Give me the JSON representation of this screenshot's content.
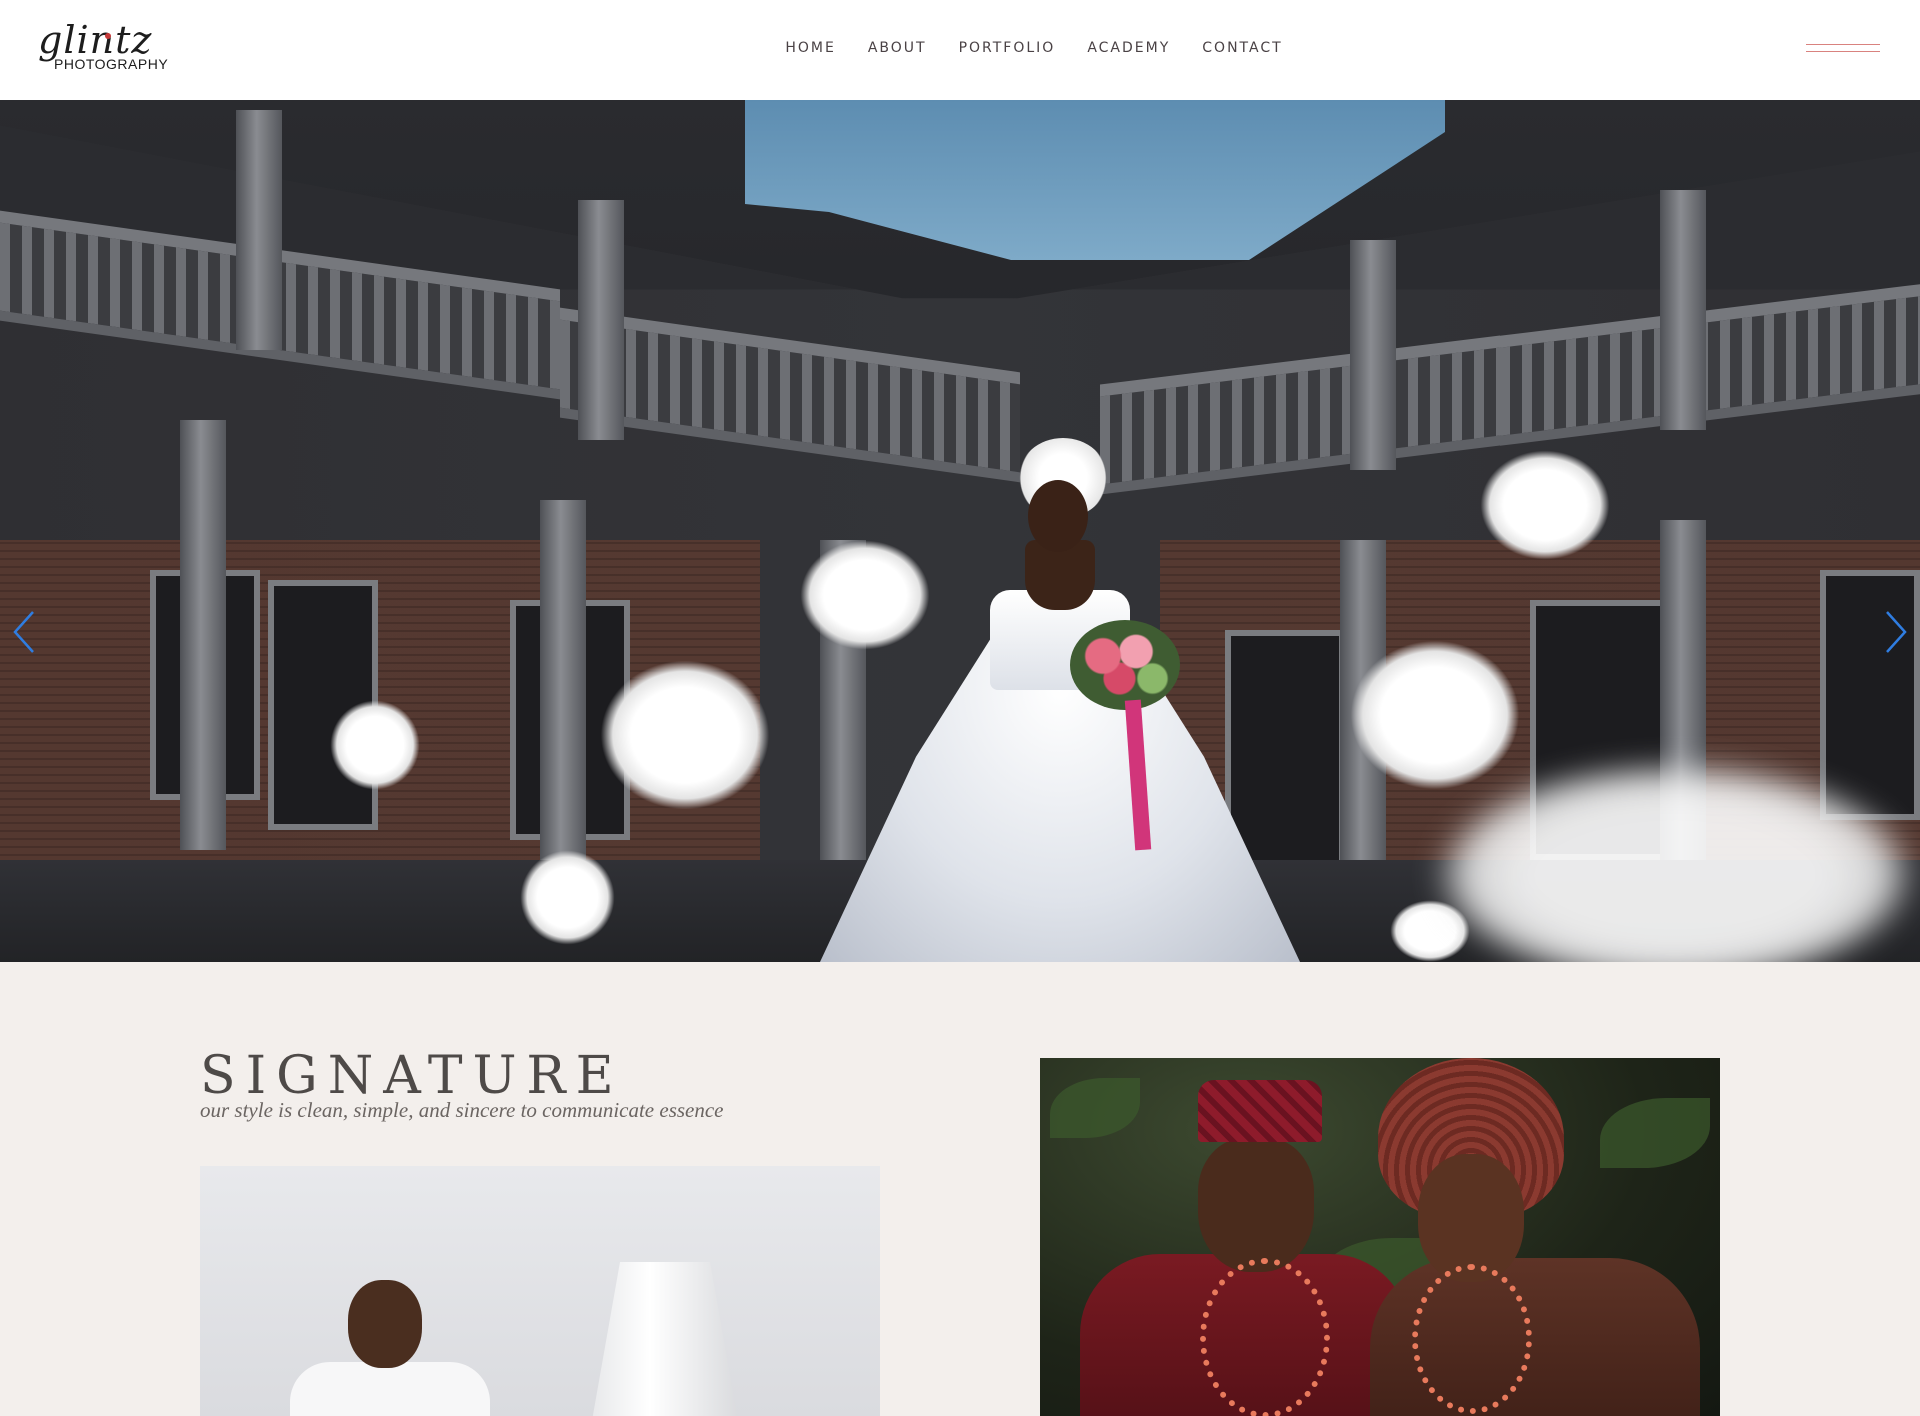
{
  "brand": {
    "logo_script": "glintz",
    "logo_sub": "PHOTOGRAPHY",
    "accent_color": "#d9827f"
  },
  "nav": {
    "items": [
      {
        "label": "HOME"
      },
      {
        "label": "ABOUT"
      },
      {
        "label": "PORTFOLIO"
      },
      {
        "label": "ACADEMY"
      },
      {
        "label": "CONTACT"
      }
    ],
    "menu_icon": "hamburger-icon"
  },
  "hero": {
    "image": "bride-with-doves-courtyard",
    "prev_icon": "chevron-left-icon",
    "next_icon": "chevron-right-icon",
    "arrow_color": "#2f7de1"
  },
  "signature": {
    "title": "SIGNATURE",
    "subtitle": "our style is clean, simple, and sincere to communicate essence"
  },
  "photos": {
    "left": "man-in-white-shirt-portrait",
    "right": "traditional-couple-portrait"
  }
}
